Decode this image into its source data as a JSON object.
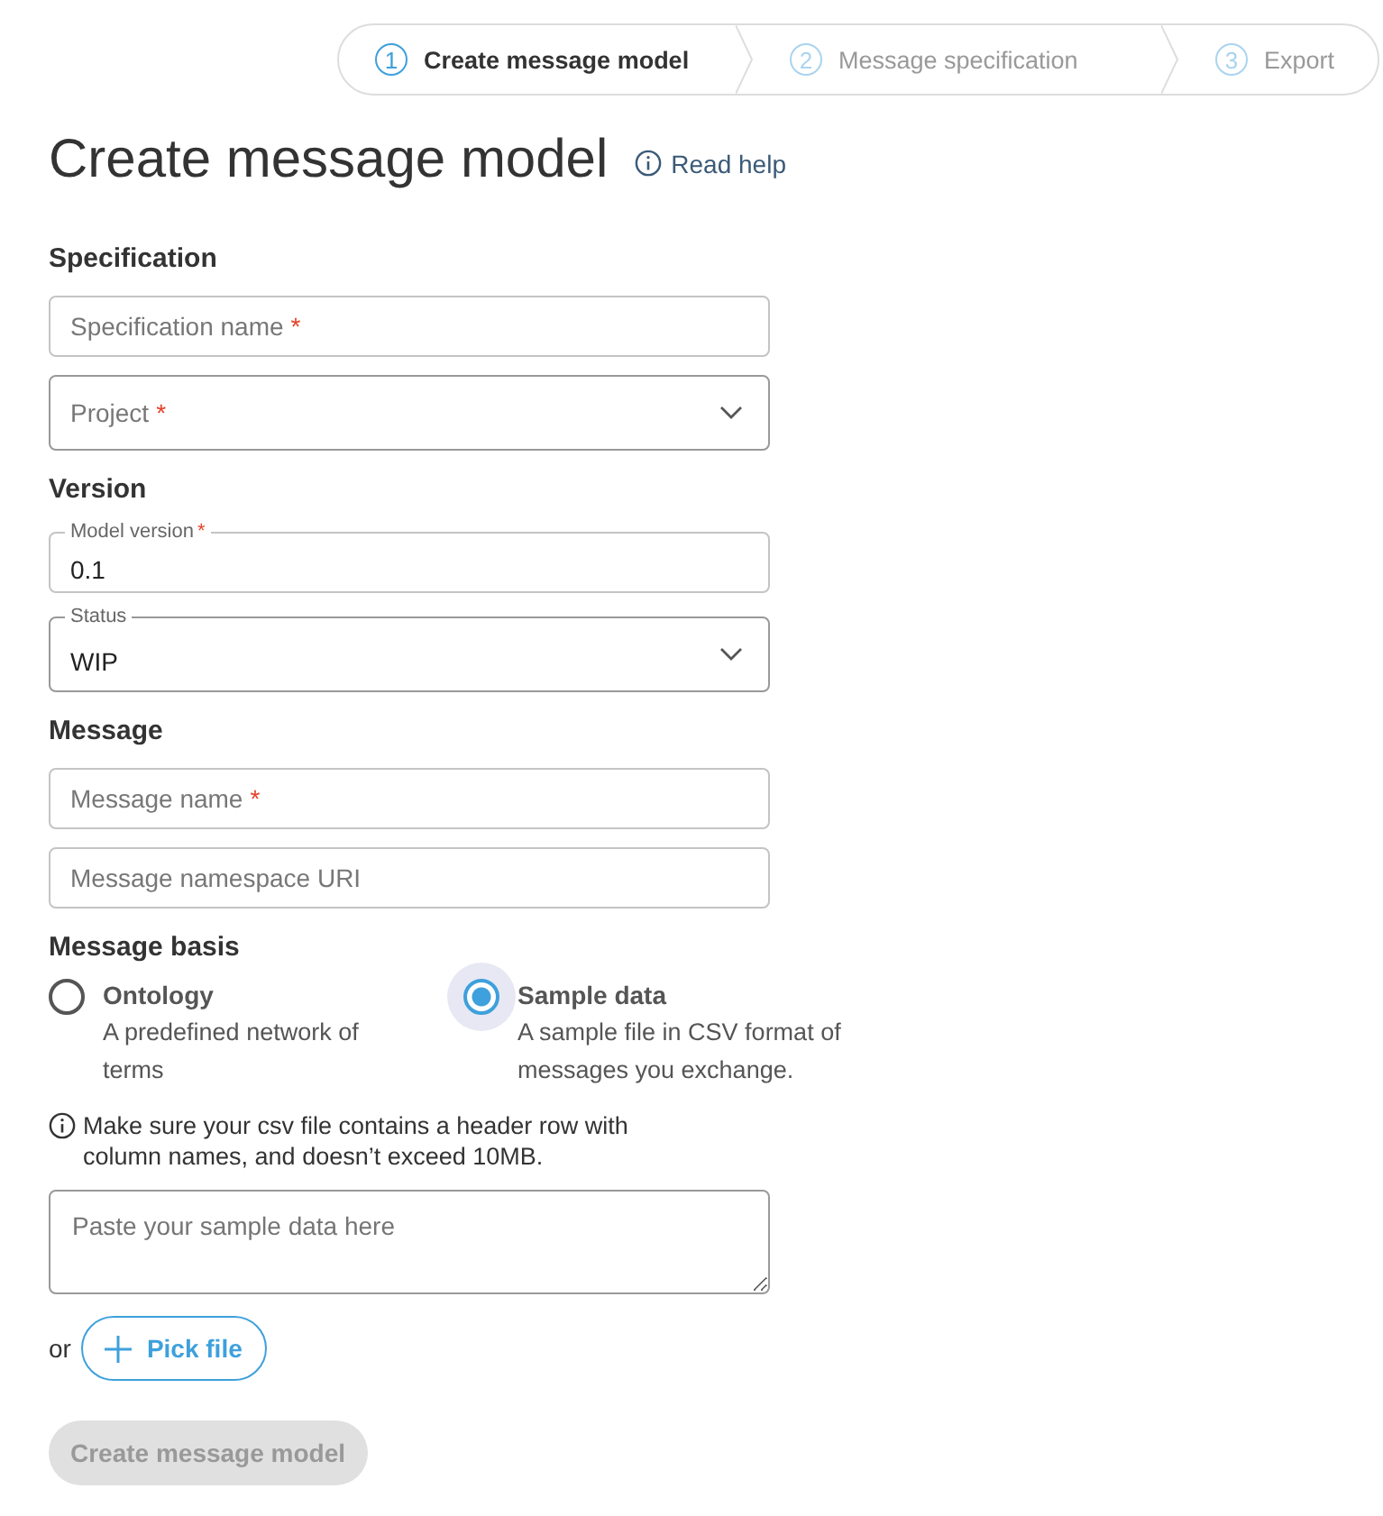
{
  "stepper": [
    {
      "number": "1",
      "label": "Create message model",
      "selected": true
    },
    {
      "number": "2",
      "label": "Message specification",
      "selected": false
    },
    {
      "number": "3",
      "label": "Export",
      "selected": false
    }
  ],
  "title": "Create message model",
  "help_link": "Read help",
  "sections": [
    {
      "heading": "Specification",
      "fields": [
        {
          "kind": "text",
          "placeholder": "Specification name",
          "required_mark": "*"
        },
        {
          "kind": "select",
          "placeholder": "Project",
          "required_mark": "*"
        }
      ]
    },
    {
      "heading": "Version",
      "fields": [
        {
          "kind": "text",
          "label": "Model version",
          "required_mark": "*",
          "value": "0.1"
        },
        {
          "kind": "select",
          "label": "Status",
          "value": "WIP"
        }
      ]
    },
    {
      "heading": "Message",
      "fields": [
        {
          "kind": "text",
          "placeholder": "Message name",
          "required_mark": "*"
        },
        {
          "kind": "text",
          "placeholder": "Message namespace URI"
        }
      ]
    }
  ],
  "message_basis": {
    "heading": "Message basis",
    "options": [
      {
        "label": "Ontology",
        "description": "A predefined network of terms",
        "selected": false
      },
      {
        "label": "Sample data",
        "description": "A sample file in CSV format of messages you exchange.",
        "selected": true
      }
    ],
    "note": "Make sure your csv file contains a header row with column names, and doesn’t exceed 10MB.",
    "sample_placeholder": "Paste your sample data here",
    "or_text": "or",
    "pick_file": "Pick file"
  },
  "submit": {
    "label": "Create message model",
    "disabled": true
  }
}
